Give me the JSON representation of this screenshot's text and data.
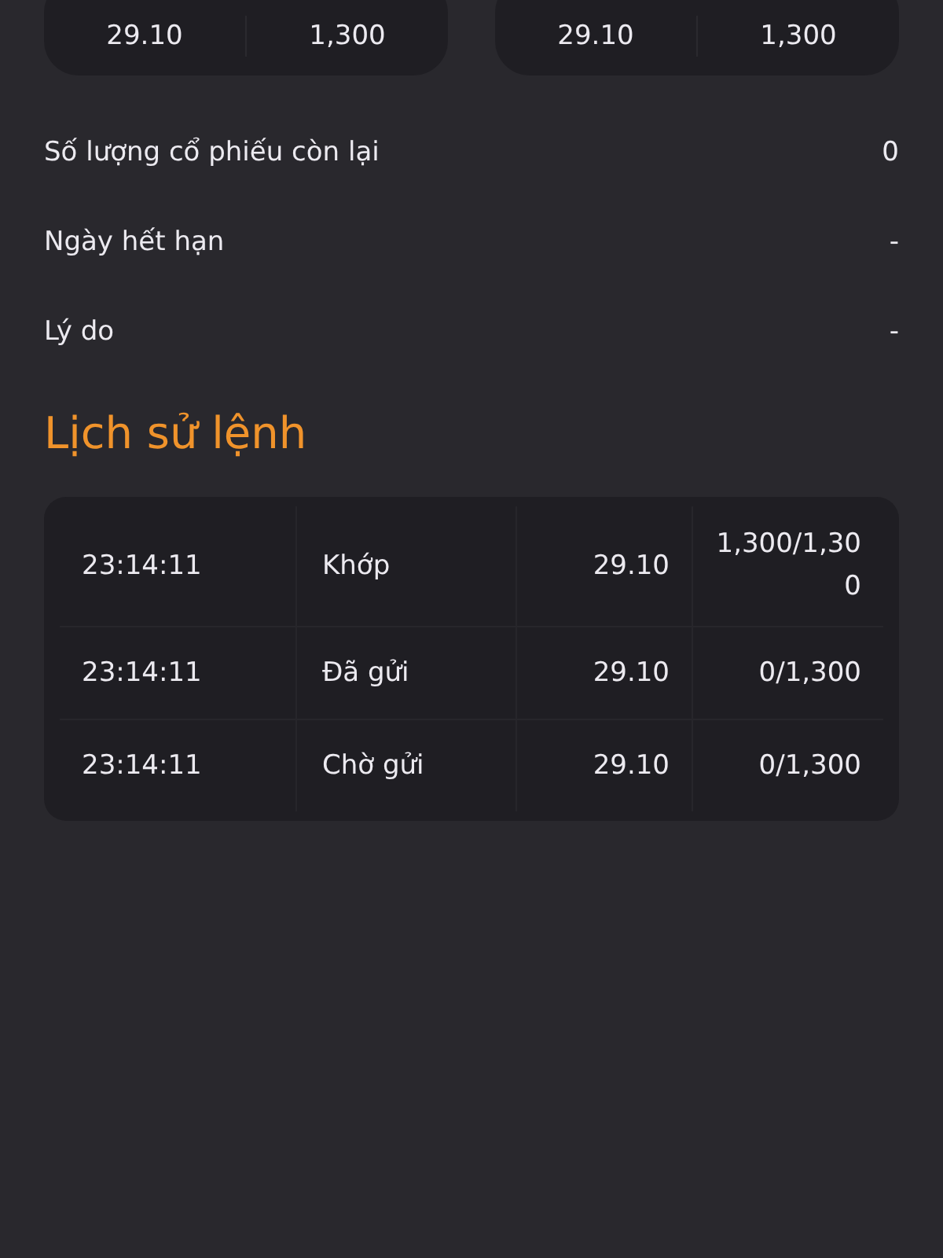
{
  "price_boxes": [
    {
      "price": "29.10",
      "quantity": "1,300"
    },
    {
      "price": "29.10",
      "quantity": "1,300"
    }
  ],
  "details": [
    {
      "label": "Số lượng cổ phiếu còn lại",
      "value": "0"
    },
    {
      "label": "Ngày hết hạn",
      "value": "-"
    },
    {
      "label": "Lý do",
      "value": "-"
    }
  ],
  "history": {
    "title": "Lịch sử lệnh",
    "rows": [
      {
        "time": "23:14:11",
        "status": "Khớp",
        "price": "29.10",
        "matched": "1,300/1,300"
      },
      {
        "time": "23:14:11",
        "status": "Đã gửi",
        "price": "29.10",
        "matched": "0/1,300"
      },
      {
        "time": "23:14:11",
        "status": "Chờ gửi",
        "price": "29.10",
        "matched": "0/1,300"
      }
    ]
  }
}
